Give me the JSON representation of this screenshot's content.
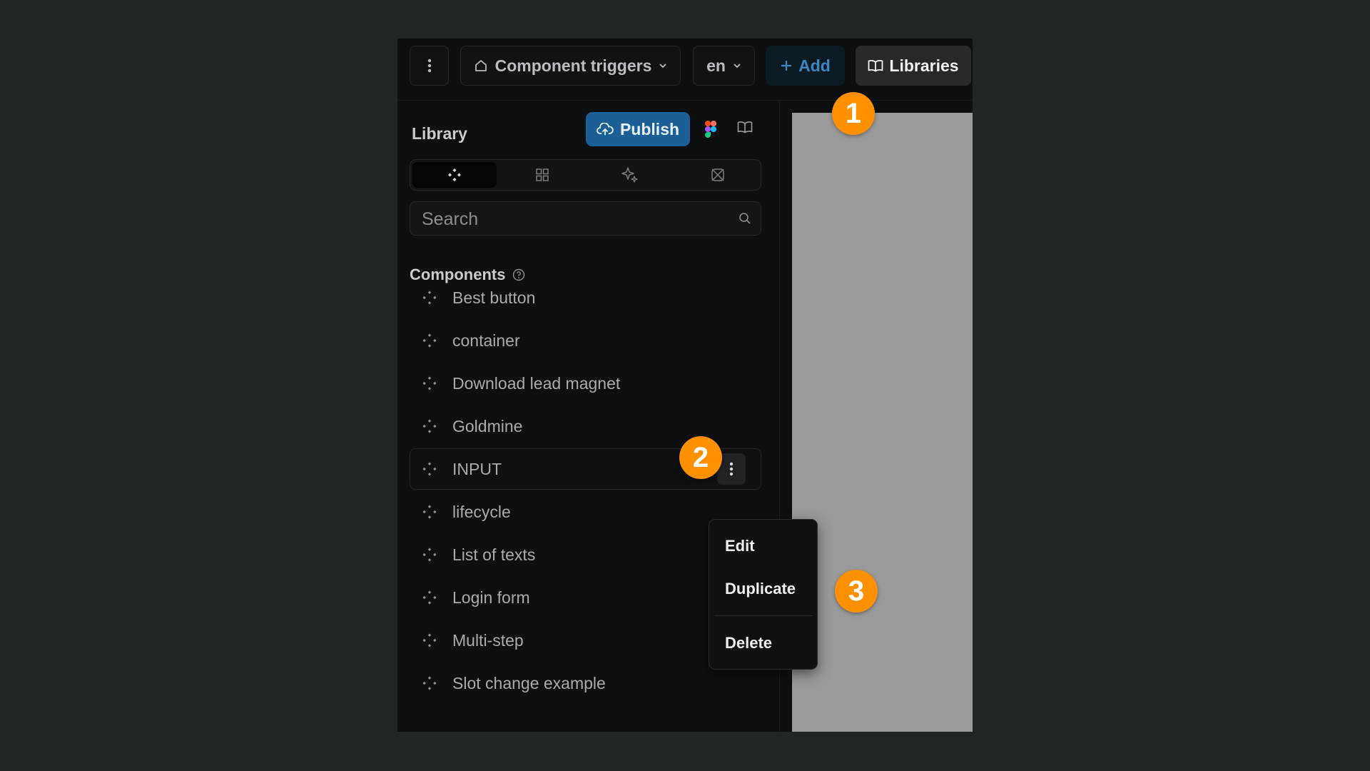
{
  "topbar": {
    "page_name": "Component triggers",
    "language": "en",
    "add_label": "Add",
    "libraries_label": "Libraries"
  },
  "sidebar": {
    "title": "Library",
    "publish_label": "Publish",
    "search_placeholder": "Search",
    "components_heading": "Components",
    "tabs": [
      "components-icon",
      "grid-icon",
      "sparkle-icon",
      "figma-outline-icon"
    ],
    "items": [
      {
        "label": "Best button"
      },
      {
        "label": "container"
      },
      {
        "label": "Download lead magnet"
      },
      {
        "label": "Goldmine"
      },
      {
        "label": "INPUT"
      },
      {
        "label": "lifecycle"
      },
      {
        "label": "List of texts"
      },
      {
        "label": "Login form"
      },
      {
        "label": "Multi-step"
      },
      {
        "label": "Slot change example"
      }
    ],
    "selected_item": "INPUT"
  },
  "context_menu": {
    "edit": "Edit",
    "duplicate": "Duplicate",
    "delete": "Delete"
  },
  "callouts": [
    "1",
    "2",
    "3"
  ],
  "colors": {
    "accent_blue": "#1b5f96",
    "callout_orange": "#ff9100",
    "background": "#202627"
  }
}
